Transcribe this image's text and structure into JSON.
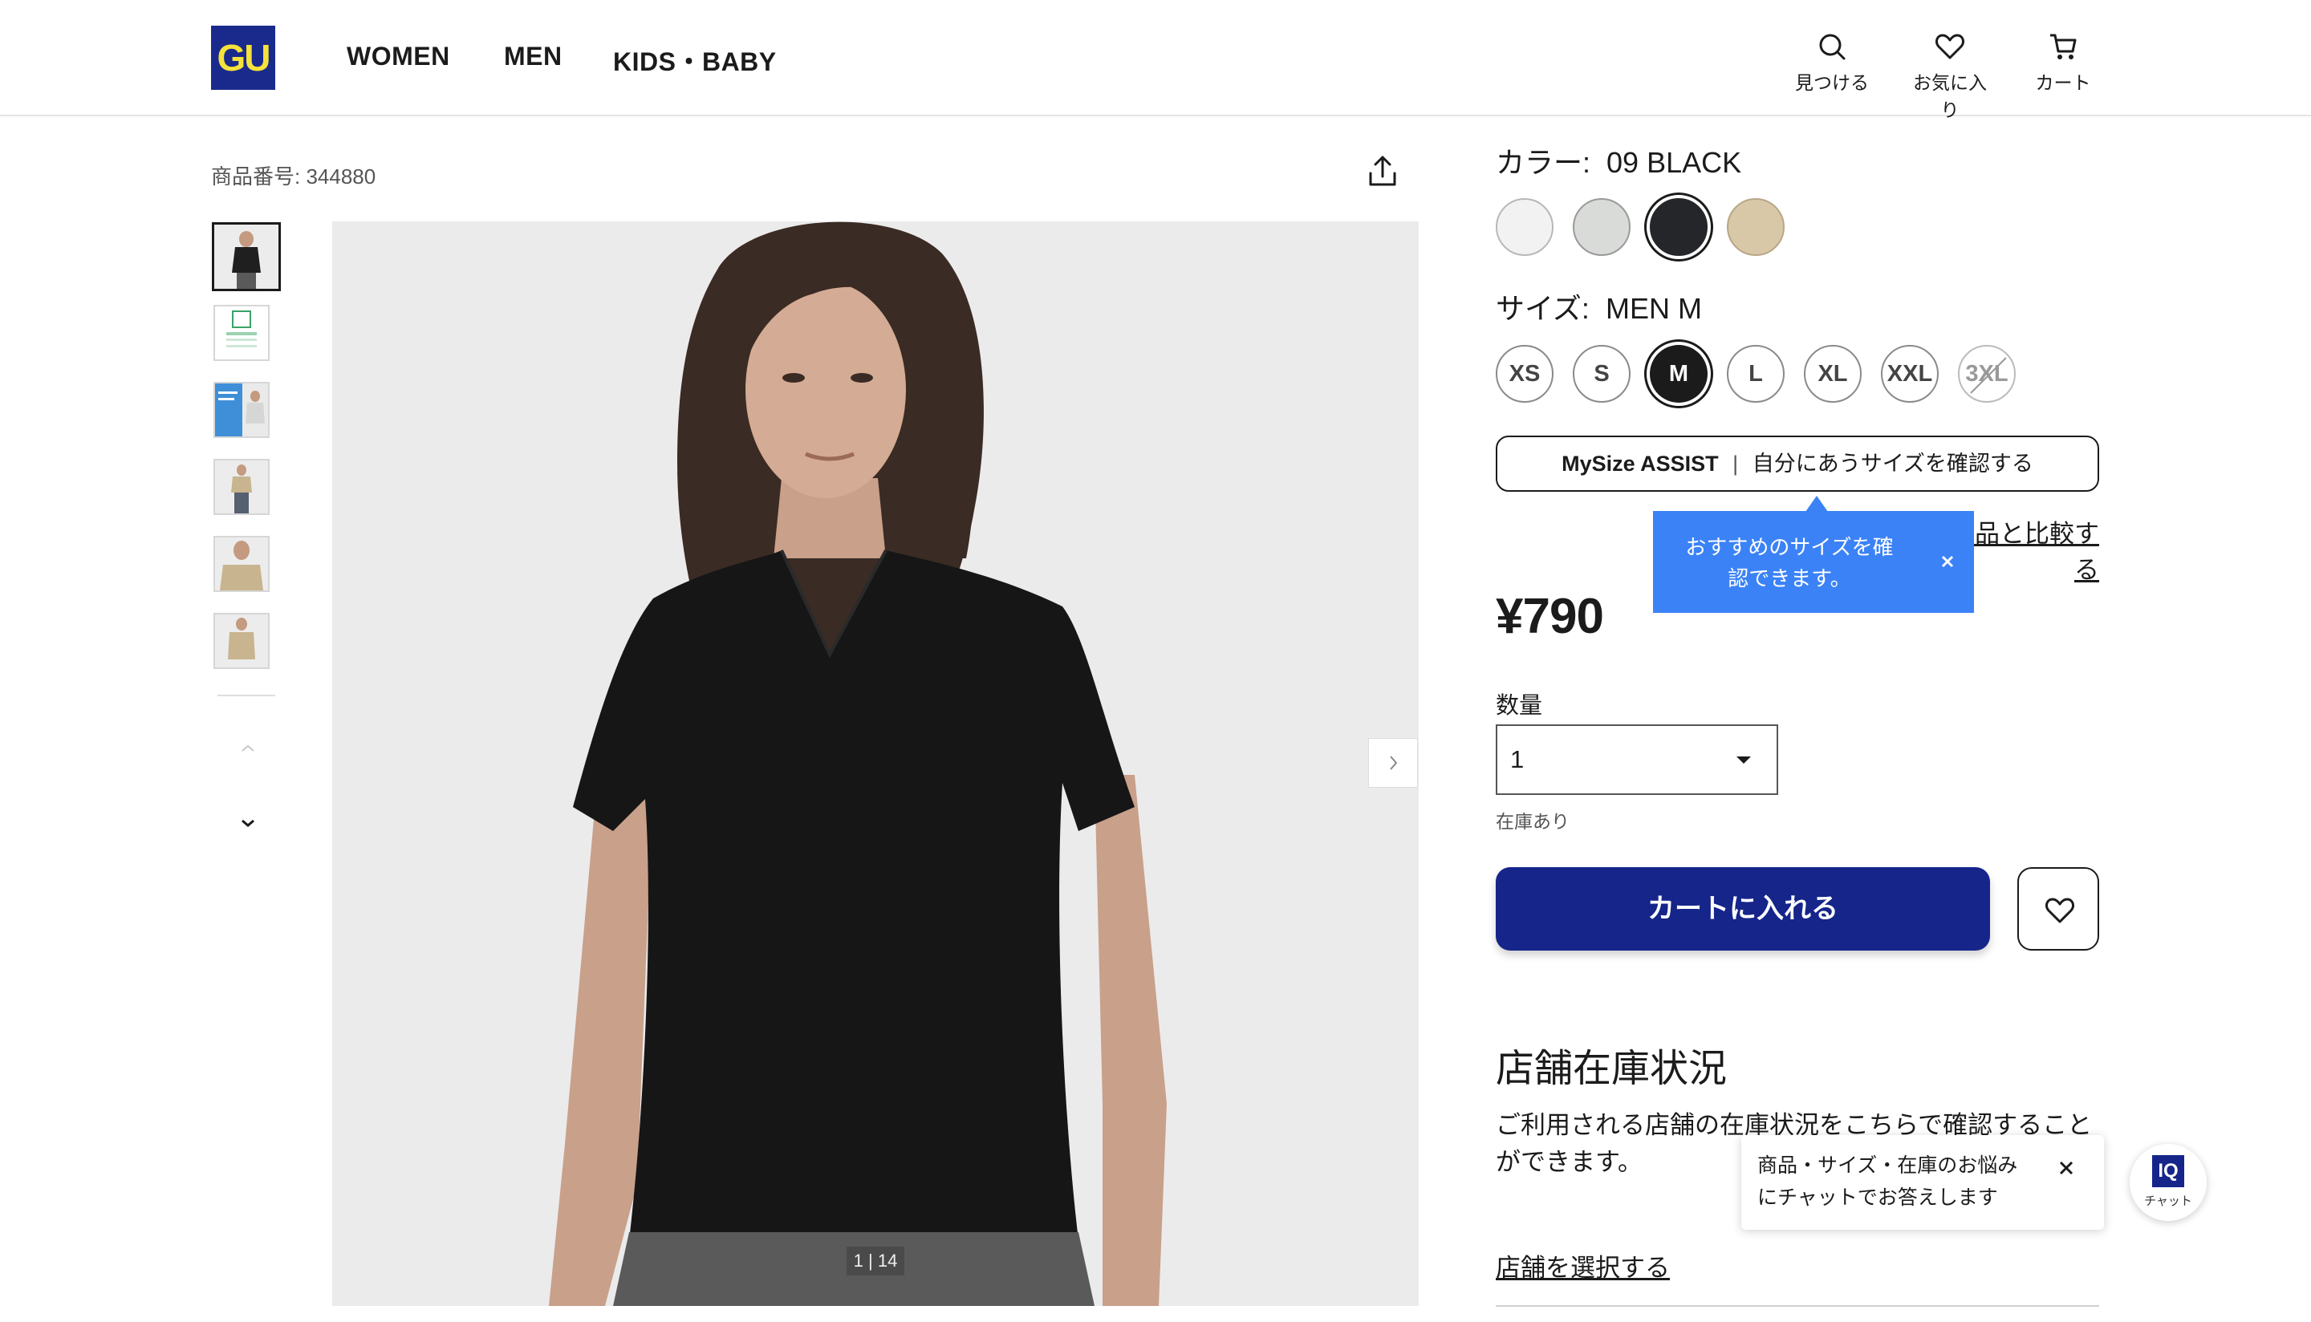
{
  "header": {
    "logo_text": "GU",
    "nav": [
      "WOMEN",
      "MEN",
      "KIDS・BABY"
    ],
    "icons": [
      {
        "name": "search-icon",
        "label": "見つける"
      },
      {
        "name": "heart-icon",
        "label": "お気に入り"
      },
      {
        "name": "cart-icon",
        "label": "カート"
      }
    ]
  },
  "gallery": {
    "product_number": "商品番号: 344880",
    "counter": "1 | 14"
  },
  "color": {
    "label": "カラー:",
    "selected": "09 BLACK",
    "swatches": [
      "#f2f2f2",
      "#d9dbd8",
      "#24262a",
      "#d8c8a8"
    ]
  },
  "size": {
    "label": "サイズ:",
    "selected": "MEN M",
    "options": [
      "XS",
      "S",
      "M",
      "L",
      "XL",
      "XXL",
      "3XL"
    ]
  },
  "mysize": {
    "brand": "MySize ASSIST",
    "text": "自分にあうサイズを確認する"
  },
  "compare_link": "ロ、サイズ表 / 購入した商品と比較する",
  "tooltip": {
    "line1": "おすすめのサイズを確",
    "line2": "認できます。"
  },
  "price": "¥790",
  "quantity": {
    "label": "数量",
    "value": "1"
  },
  "stock_status": "在庫あり",
  "add_to_cart": "カートに入れる",
  "store": {
    "title": "店舗在庫状況",
    "description": "ご利用される店舗の在庫状況をこちらで確認することができます。",
    "link": "店舗を選択する"
  },
  "chat": {
    "line1": "商品・サイズ・在庫のお悩み",
    "line2": "にチャットでお答えします",
    "badge": "IQ",
    "badge_label": "チャット"
  },
  "colors": {
    "brand_blue": "#15258a",
    "tooltip_blue": "#3b82f6",
    "logo_yellow": "#f5e23a"
  }
}
